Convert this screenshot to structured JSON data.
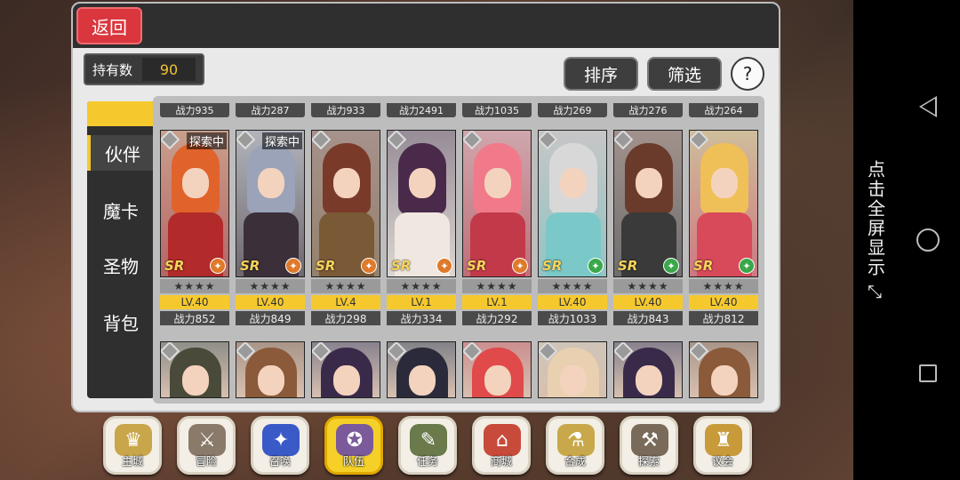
{
  "header": {
    "back_label": "返回"
  },
  "holding": {
    "label": "持有数",
    "value": "90"
  },
  "toolbar": {
    "sort_label": "排序",
    "filter_label": "筛选",
    "help_label": "?"
  },
  "tabs": [
    {
      "label": "伙伴",
      "active": true
    },
    {
      "label": "魔卡",
      "active": false
    },
    {
      "label": "圣物",
      "active": false
    },
    {
      "label": "背包",
      "active": false
    }
  ],
  "top_row_power": [
    "战力935",
    "战力287",
    "战力933",
    "战力2491",
    "战力1035",
    "战力269",
    "战力276",
    "战力264"
  ],
  "cards": [
    {
      "badge": "探索中",
      "rank": "SR",
      "stars": "★★★★",
      "level": "LV.40",
      "power": "战力852",
      "hair": "#e0632b",
      "body": "#b22a2a",
      "elem": "#e07a2b"
    },
    {
      "badge": "探索中",
      "rank": "SR",
      "stars": "★★★★",
      "level": "LV.40",
      "power": "战力849",
      "hair": "#9aa3b8",
      "body": "#3b2f3a",
      "elem": "#e07a2b"
    },
    {
      "badge": "",
      "rank": "SR",
      "stars": "★★★★",
      "level": "LV.4",
      "power": "战力298",
      "hair": "#7a3a2a",
      "body": "#7a5a36",
      "elem": "#e07a2b"
    },
    {
      "badge": "",
      "rank": "SR",
      "stars": "★★★★",
      "level": "LV.1",
      "power": "战力334",
      "hair": "#4a2a4a",
      "body": "#f0e8e0",
      "elem": "#e07a2b"
    },
    {
      "badge": "",
      "rank": "SR",
      "stars": "★★★★",
      "level": "LV.1",
      "power": "战力292",
      "hair": "#f07a8a",
      "body": "#c23a4a",
      "elem": "#e07a2b"
    },
    {
      "badge": "",
      "rank": "SR",
      "stars": "★★★★",
      "level": "LV.40",
      "power": "战力1033",
      "hair": "#d8d8d8",
      "body": "#7ac8c8",
      "elem": "#3aa84a"
    },
    {
      "badge": "",
      "rank": "SR",
      "stars": "★★★★",
      "level": "LV.40",
      "power": "战力843",
      "hair": "#6a3a2a",
      "body": "#3a3a3a",
      "elem": "#3aa84a"
    },
    {
      "badge": "",
      "rank": "SR",
      "stars": "★★★★",
      "level": "LV.40",
      "power": "战力812",
      "hair": "#f0c058",
      "body": "#d84a5a",
      "elem": "#3aa84a"
    }
  ],
  "row3": [
    {
      "hair": "#4a4a3a"
    },
    {
      "hair": "#8a5a3a"
    },
    {
      "hair": "#3a2a4a"
    },
    {
      "hair": "#2a2a3a"
    },
    {
      "hair": "#e04a4a"
    },
    {
      "hair": "#e8d0b0"
    },
    {
      "hair": "#3a2a4a"
    },
    {
      "hair": "#8a5a3a"
    }
  ],
  "menu": [
    {
      "label": "主城",
      "icon": "♛",
      "color": "#c9a64a",
      "active": false
    },
    {
      "label": "冒险",
      "icon": "⚔",
      "color": "#8a7a6a",
      "active": false
    },
    {
      "label": "召唤",
      "icon": "✦",
      "color": "#3a5ac8",
      "active": false
    },
    {
      "label": "队伍",
      "icon": "✪",
      "color": "#7a5a9a",
      "active": true
    },
    {
      "label": "任务",
      "icon": "✎",
      "color": "#6a7a4a",
      "active": false
    },
    {
      "label": "商城",
      "icon": "⌂",
      "color": "#c84a3a",
      "active": false
    },
    {
      "label": "合成",
      "icon": "⚗",
      "color": "#c8a84a",
      "active": false
    },
    {
      "label": "探索",
      "icon": "⚒",
      "color": "#7a6a5a",
      "active": false
    },
    {
      "label": "议会",
      "icon": "♜",
      "color": "#c89a3a",
      "active": false
    }
  ],
  "system": {
    "fullscreen_hint": "点击全屏显示"
  }
}
